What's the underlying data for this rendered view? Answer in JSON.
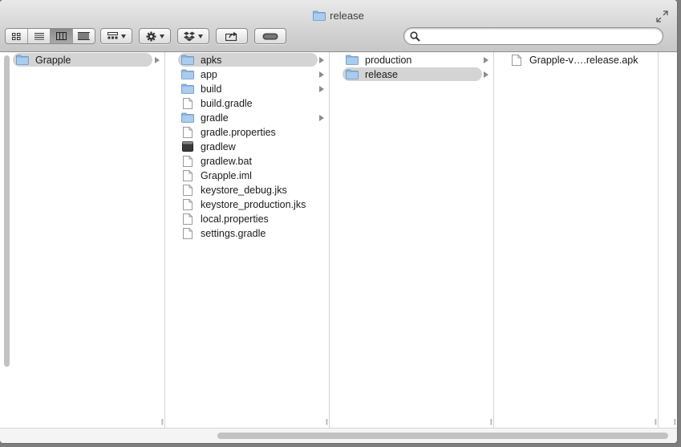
{
  "window": {
    "title": "release"
  },
  "toolbar": {
    "view_buttons": [
      {
        "name": "icon-view",
        "icon": "icon-view-icon"
      },
      {
        "name": "list-view",
        "icon": "list-view-icon"
      },
      {
        "name": "column-view",
        "icon": "column-view-icon",
        "active": true
      },
      {
        "name": "coverflow-view",
        "icon": "coverflow-view-icon"
      }
    ],
    "arrange_icon": "arrange-icon",
    "action_icon": "gear-icon",
    "dropbox_icon": "dropbox-icon",
    "share_icon": "share-icon",
    "tags_icon": "toggle-icon"
  },
  "search": {
    "placeholder": "",
    "value": ""
  },
  "columns": [
    {
      "items": [
        {
          "label": "Grapple",
          "kind": "folder",
          "selected": true,
          "arrow": true
        }
      ]
    },
    {
      "items": [
        {
          "label": "apks",
          "kind": "folder",
          "selected": true,
          "arrow": true
        },
        {
          "label": "app",
          "kind": "folder",
          "arrow": true
        },
        {
          "label": "build",
          "kind": "folder",
          "arrow": true
        },
        {
          "label": "build.gradle",
          "kind": "file"
        },
        {
          "label": "gradle",
          "kind": "folder",
          "arrow": true
        },
        {
          "label": "gradle.properties",
          "kind": "file"
        },
        {
          "label": "gradlew",
          "kind": "exec"
        },
        {
          "label": "gradlew.bat",
          "kind": "file"
        },
        {
          "label": "Grapple.iml",
          "kind": "file"
        },
        {
          "label": "keystore_debug.jks",
          "kind": "file"
        },
        {
          "label": "keystore_production.jks",
          "kind": "file"
        },
        {
          "label": "local.properties",
          "kind": "file"
        },
        {
          "label": "settings.gradle",
          "kind": "file"
        }
      ]
    },
    {
      "items": [
        {
          "label": "production",
          "kind": "folder",
          "arrow": true
        },
        {
          "label": "release",
          "kind": "folder",
          "selected": true,
          "arrow": true
        }
      ]
    },
    {
      "items": [
        {
          "label": "Grapple-v….release.apk",
          "kind": "file"
        }
      ]
    }
  ],
  "colors": {
    "selection": "#d4d4d4",
    "folder": "#7aa6d6"
  }
}
